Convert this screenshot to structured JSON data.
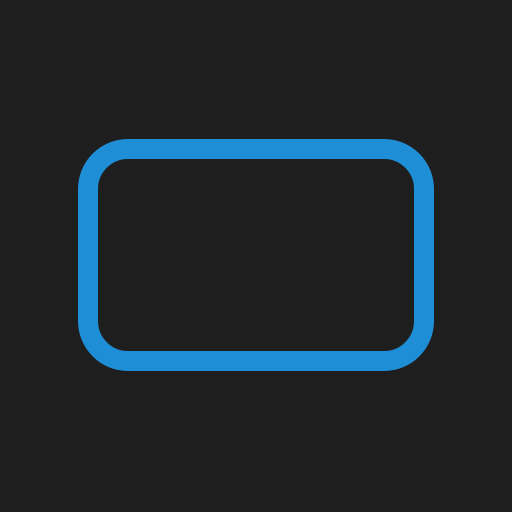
{
  "icon": {
    "name": "rounded-rectangle-icon",
    "stroke_color": "#1e8fd6",
    "background_color": "#1e1e1e"
  }
}
